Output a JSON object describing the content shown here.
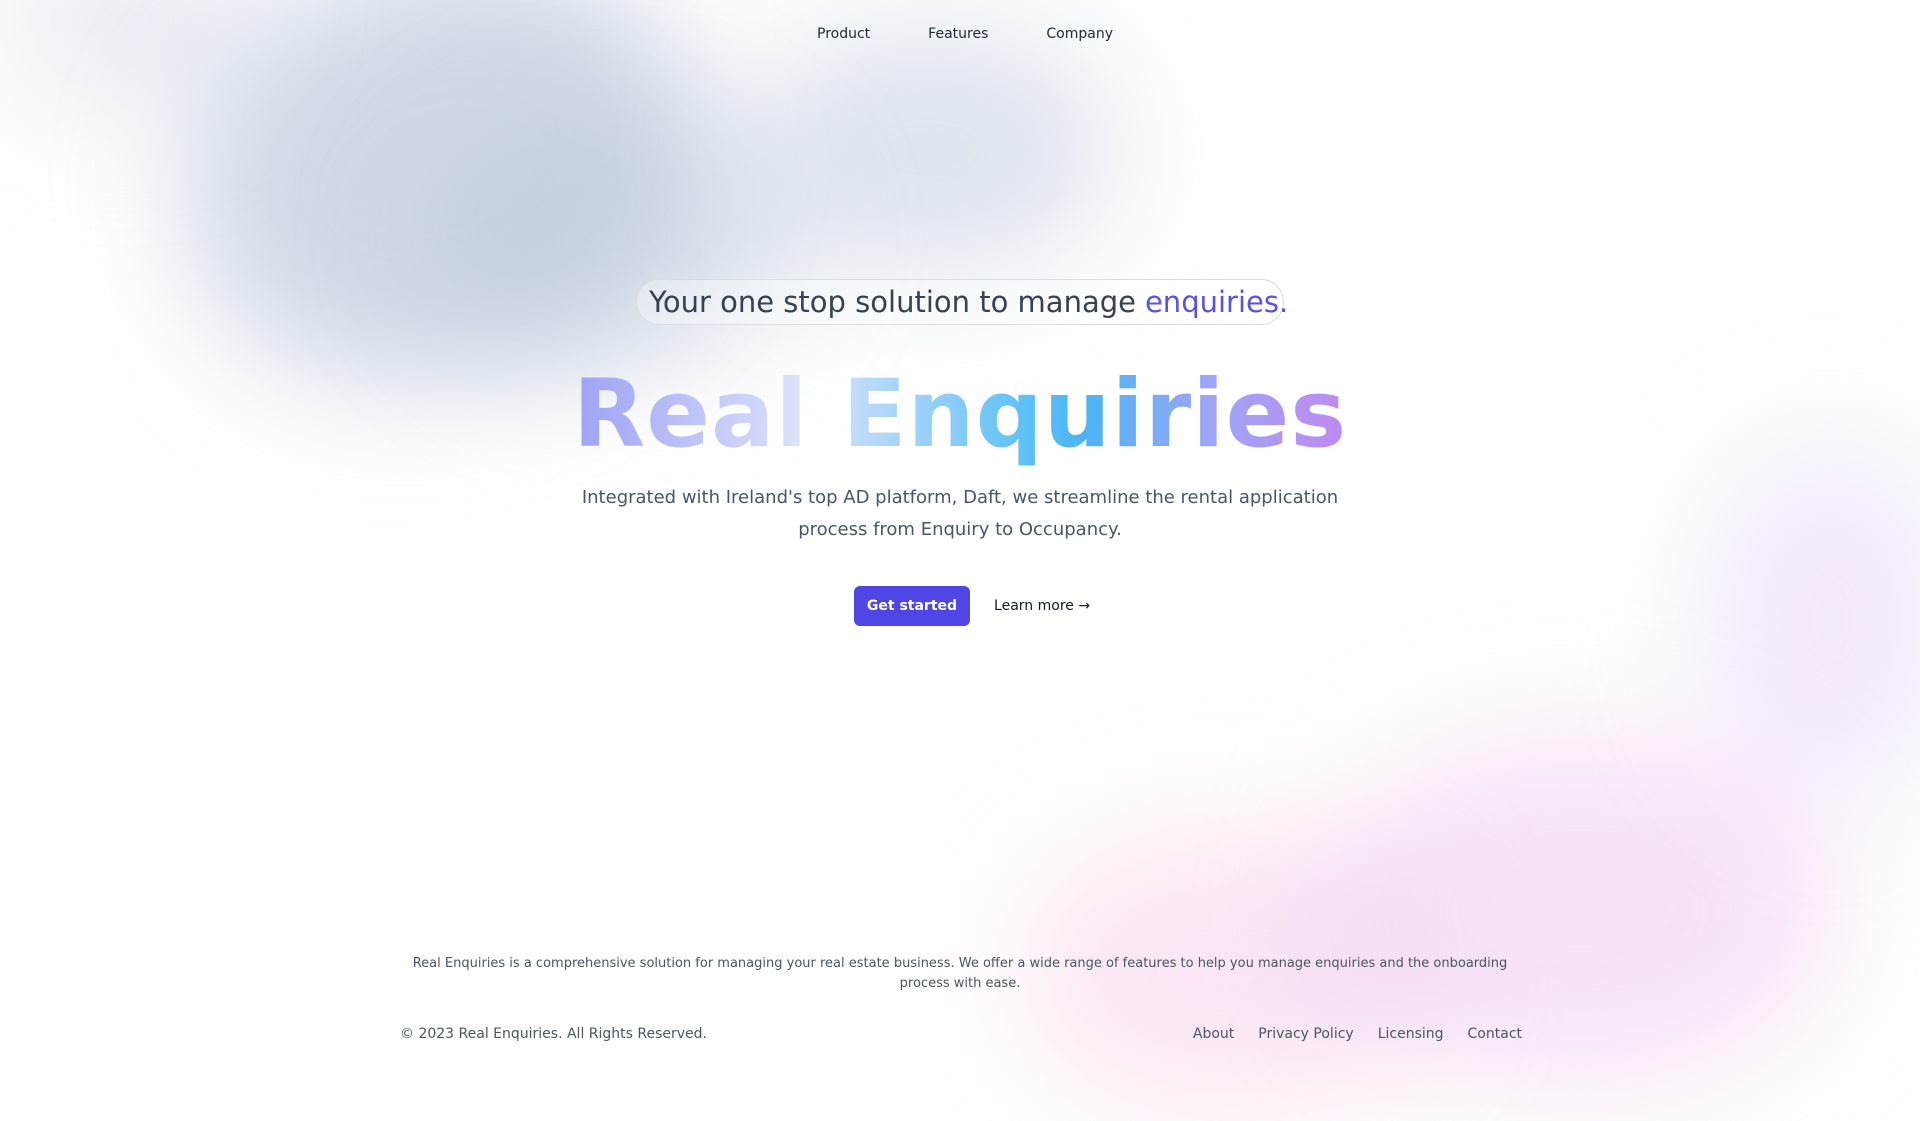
{
  "nav": {
    "items": [
      "Product",
      "Features",
      "Company"
    ]
  },
  "hero": {
    "tagline_prefix": "Your one stop solution to manage",
    "tagline_accent": "enquiries.",
    "title": "Real Enquiries",
    "subtitle": "Integrated with Ireland's top AD platform, Daft, we streamline the rental application process from Enquiry to Occupancy.",
    "primary_cta": "Get started",
    "secondary_cta": "Learn more →"
  },
  "footer": {
    "description": "Real Enquiries is a comprehensive solution for managing your real estate business. We offer a wide range of features to help you manage enquiries and the onboarding process with ease.",
    "copyright": "© 2023 Real Enquiries. All Rights Reserved.",
    "links": [
      "About",
      "Privacy Policy",
      "Licensing",
      "Contact"
    ]
  },
  "colors": {
    "accent": "#4f46e5",
    "tagline_accent": "#5b52e0",
    "text_dark": "#111827",
    "text_muted": "#4b5563"
  }
}
